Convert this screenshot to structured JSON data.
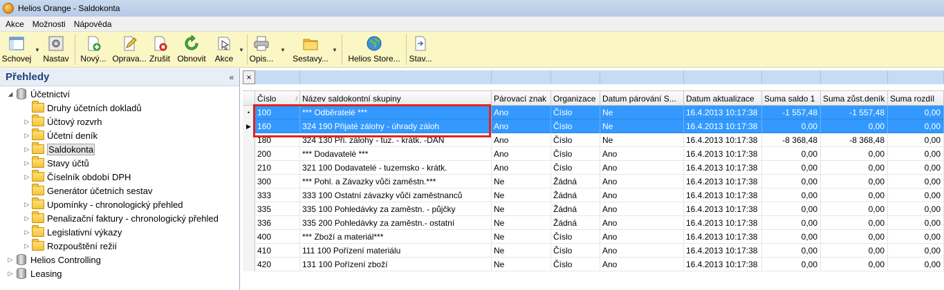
{
  "window": {
    "title": "Helios Orange - Saldokonta"
  },
  "menu": [
    "Akce",
    "Možnosti",
    "Nápověda"
  ],
  "toolbar": {
    "buttons": [
      {
        "label": "Schovej",
        "icon": "window-icon"
      },
      {
        "label": "Nastav",
        "icon": "settings-icon"
      },
      {
        "label": "Nový...",
        "icon": "new-document-icon"
      },
      {
        "label": "Oprava...",
        "icon": "edit-icon"
      },
      {
        "label": "Zrušit",
        "icon": "delete-icon"
      },
      {
        "label": "Obnovit",
        "icon": "refresh-icon"
      },
      {
        "label": "Akce",
        "icon": "cursor-icon"
      },
      {
        "label": "Opis...",
        "icon": "printer-icon"
      },
      {
        "label": "Sestavy...",
        "icon": "folder-icon"
      },
      {
        "label": "Helios Store...",
        "icon": "globe-icon"
      },
      {
        "label": "Stav...",
        "icon": "document-arrow-icon"
      }
    ]
  },
  "sidebar": {
    "title": "Přehledy",
    "collapse_glyph": "«",
    "items": [
      {
        "label": "Účetnictví",
        "type": "db",
        "level": 0,
        "toggle": "◢"
      },
      {
        "label": "Druhy účetních dokladů",
        "type": "folder",
        "level": 1,
        "toggle": ""
      },
      {
        "label": "Účtový rozvrh",
        "type": "folder",
        "level": 1,
        "toggle": "▷"
      },
      {
        "label": "Účetní deník",
        "type": "folder",
        "level": 1,
        "toggle": "▷"
      },
      {
        "label": "Saldokonta",
        "type": "folder",
        "level": 1,
        "toggle": "▷",
        "selected": true
      },
      {
        "label": "Stavy účtů",
        "type": "folder",
        "level": 1,
        "toggle": "▷"
      },
      {
        "label": "Číselník období DPH",
        "type": "folder",
        "level": 1,
        "toggle": "▷"
      },
      {
        "label": "Generátor účetních sestav",
        "type": "folder",
        "level": 1,
        "toggle": ""
      },
      {
        "label": "Upomínky - chronologický přehled",
        "type": "folder",
        "level": 1,
        "toggle": "▷"
      },
      {
        "label": "Penalizační faktury - chronologický přehled",
        "type": "folder",
        "level": 1,
        "toggle": "▷"
      },
      {
        "label": "Legislativní výkazy",
        "type": "folder",
        "level": 1,
        "toggle": "▷"
      },
      {
        "label": "Rozpouštění režií",
        "type": "folder",
        "level": 1,
        "toggle": "▷"
      },
      {
        "label": "Helios Controlling",
        "type": "db",
        "level": 0,
        "toggle": "▷"
      },
      {
        "label": "Leasing",
        "type": "db",
        "level": 0,
        "toggle": "▷"
      }
    ]
  },
  "grid": {
    "filter_close": "×",
    "columns": [
      "Číslo",
      "Název saldokontní skupiny",
      "Párovací znak",
      "Organizace",
      "Datum párování S...",
      "Datum aktualizace",
      "Suma saldo 1",
      "Suma zůst.deník",
      "Suma rozdíl"
    ],
    "sort_indicator": "/",
    "rows": [
      {
        "ind": "•",
        "sel": true,
        "cells": [
          "100",
          "*** Odběratelé ***",
          "Ano",
          "Číslo",
          "Ne",
          "16.4.2013 10:17:38",
          "-1 557,48",
          "-1 557,48",
          "0,00"
        ]
      },
      {
        "ind": "▶",
        "sel": true,
        "cells": [
          "160",
          "324 190 Přijaté zálohy - úhrady záloh",
          "Ano",
          "Číslo",
          "Ne",
          "16.4.2013 10:17:38",
          "0,00",
          "0,00",
          "0,00"
        ]
      },
      {
        "ind": "",
        "sel": false,
        "cells": [
          "180",
          "324 130 Při. zálohy - tuz. - krátk. -DAŇ",
          "Ano",
          "Číslo",
          "Ne",
          "16.4.2013 10:17:38",
          "-8 368,48",
          "-8 368,48",
          "0,00"
        ]
      },
      {
        "ind": "",
        "sel": false,
        "cells": [
          "200",
          "*** Dodavatelé ***",
          "Ano",
          "Číslo",
          "Ano",
          "16.4.2013 10:17:38",
          "0,00",
          "0,00",
          "0,00"
        ]
      },
      {
        "ind": "",
        "sel": false,
        "cells": [
          "210",
          "321 100 Dodavatelé - tuzemsko - krátk.",
          "Ano",
          "Číslo",
          "Ano",
          "16.4.2013 10:17:38",
          "0,00",
          "0,00",
          "0,00"
        ]
      },
      {
        "ind": "",
        "sel": false,
        "cells": [
          "300",
          "*** Pohl. a Závazky vůči zaměstn.***",
          "Ne",
          "Žádná",
          "Ano",
          "16.4.2013 10:17:38",
          "0,00",
          "0,00",
          "0,00"
        ]
      },
      {
        "ind": "",
        "sel": false,
        "cells": [
          "333",
          "333 100 Ostatní závazky vůči zaměstnanců",
          "Ne",
          "Žádná",
          "Ano",
          "16.4.2013 10:17:38",
          "0,00",
          "0,00",
          "0,00"
        ]
      },
      {
        "ind": "",
        "sel": false,
        "cells": [
          "335",
          "335 100 Pohledávky za zaměstn. - půjčky",
          "Ne",
          "Žádná",
          "Ano",
          "16.4.2013 10:17:38",
          "0,00",
          "0,00",
          "0,00"
        ]
      },
      {
        "ind": "",
        "sel": false,
        "cells": [
          "336",
          "335 200 Pohledávky za zaměstn.- ostatní",
          "Ne",
          "Žádná",
          "Ano",
          "16.4.2013 10:17:38",
          "0,00",
          "0,00",
          "0,00"
        ]
      },
      {
        "ind": "",
        "sel": false,
        "cells": [
          "400",
          "*** Zboží a materiál***",
          "Ne",
          "Číslo",
          "Ano",
          "16.4.2013 10:17:38",
          "0,00",
          "0,00",
          "0,00"
        ]
      },
      {
        "ind": "",
        "sel": false,
        "cells": [
          "410",
          "111 100 Pořízení materiálu",
          "Ne",
          "Číslo",
          "Ano",
          "16.4.2013 10:17:38",
          "0,00",
          "0,00",
          "0,00"
        ]
      },
      {
        "ind": "",
        "sel": false,
        "cells": [
          "420",
          "131 100 Pořízení zboží",
          "Ne",
          "Číslo",
          "Ano",
          "16.4.2013 10:17:38",
          "0,00",
          "0,00",
          "0,00"
        ]
      }
    ]
  }
}
